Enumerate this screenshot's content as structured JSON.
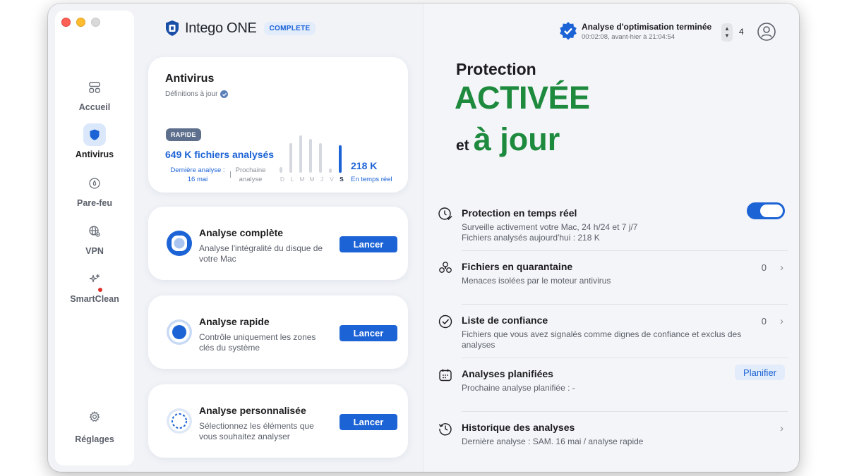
{
  "sidebar": {
    "items": [
      {
        "label": "Accueil",
        "icon": "home-icon"
      },
      {
        "label": "Antivirus",
        "icon": "shield-icon"
      },
      {
        "label": "Pare-feu",
        "icon": "firewall-icon"
      },
      {
        "label": "VPN",
        "icon": "vpn-globe-icon"
      },
      {
        "label": "SmartClean",
        "icon": "sparkle-icon"
      }
    ],
    "settings_label": "Réglages",
    "active_index": 1
  },
  "brand": {
    "name": "Intego ONE",
    "badge": "COMPLETE"
  },
  "antivirus_card": {
    "title": "Antivirus",
    "subtitle": "Définitions à jour",
    "mode_pill": "RAPIDE",
    "files_scanned": "649 K fichiers analysés",
    "last_scan_label": "Dernière analyse :",
    "last_scan_date": "16 mai",
    "next_scan_label": "Prochaine",
    "next_scan_label2": "analyse",
    "days": [
      "D",
      "L",
      "M",
      "M",
      "J",
      "V",
      "S"
    ],
    "day_levels": [
      0.15,
      0.75,
      0.95,
      0.85,
      0.75,
      0.1,
      0.7
    ],
    "active_day_index": 6,
    "realtime_value": "218 K",
    "realtime_label": "En temps réel"
  },
  "scans": [
    {
      "title": "Analyse complète",
      "desc": "Analyse l'intégralité du disque de votre Mac",
      "button": "Lancer"
    },
    {
      "title": "Analyse rapide",
      "desc": "Contrôle uniquement les zones clés du système",
      "button": "Lancer"
    },
    {
      "title": "Analyse personnalisée",
      "desc": "Sélectionnez les éléments que vous souhaitez analyser",
      "button": "Lancer"
    }
  ],
  "notification": {
    "title": "Analyse d'optimisation terminée",
    "time": "00:02:08, avant-hier à 21:04:54",
    "count": "4"
  },
  "status": {
    "line1": "Protection",
    "line2": "ACTIVÉE",
    "line3_prefix": "et",
    "line3": "à jour"
  },
  "rows": {
    "realtime": {
      "title": "Protection en temps réel",
      "desc1": "Surveille activement votre Mac, 24 h/24 et 7 j/7",
      "desc2": "Fichiers analysés aujourd'hui :  218 K",
      "enabled": true
    },
    "quarantine": {
      "title": "Fichiers en quarantaine",
      "desc": "Menaces isolées par le moteur antivirus",
      "count": "0"
    },
    "trust": {
      "title": "Liste de confiance",
      "desc": "Fichiers que vous avez signalés comme dignes de confiance et exclus des analyses",
      "count": "0"
    },
    "scheduled": {
      "title": "Analyses planifiées",
      "desc": "Prochaine analyse planifiée :  -",
      "button": "Planifier"
    },
    "history": {
      "title": "Historique des analyses",
      "desc": "Dernière analyse :   SAM. 16 mai   /   analyse rapide"
    }
  },
  "colors": {
    "accent": "#1c63d6",
    "success": "#1d8a3e",
    "badge_bg": "#e2ecfa"
  }
}
